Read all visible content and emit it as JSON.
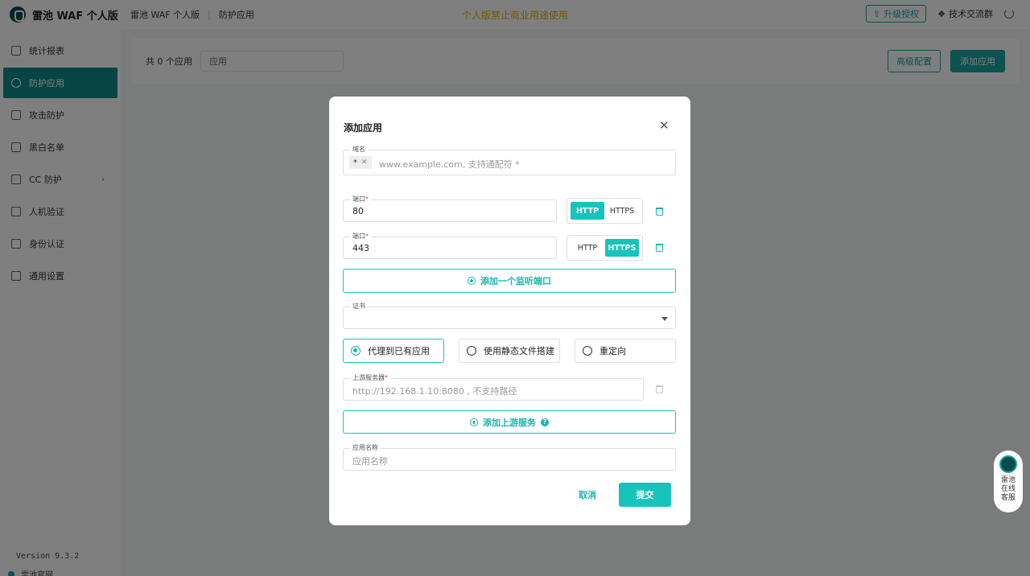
{
  "topbar": {
    "brand": "雷池 WAF 个人版",
    "breadcrumb": [
      "雷池 WAF 个人版",
      "防护应用"
    ],
    "notice": "个人版禁止商业用途使用",
    "upgrade_label": "升级授权",
    "tech_group_label": "技术交流群"
  },
  "sidebar": {
    "items": [
      {
        "label": "统计报表",
        "icon": "chart-icon"
      },
      {
        "label": "防护应用",
        "icon": "shield-icon"
      },
      {
        "label": "攻击防护",
        "icon": "document-icon"
      },
      {
        "label": "黑白名单",
        "icon": "list-icon"
      },
      {
        "label": "CC 防护",
        "icon": "wrench-icon"
      },
      {
        "label": "人机验证",
        "icon": "robot-icon"
      },
      {
        "label": "身份认证",
        "icon": "key-icon"
      },
      {
        "label": "通用设置",
        "icon": "gear-icon"
      }
    ],
    "active_index": 1,
    "version": "Version 9.3.2",
    "website": "雷池官网"
  },
  "main": {
    "count_text": "共 0 个应用",
    "search_value": "应用",
    "advanced_label": "高级配置",
    "add_app_label": "添加应用"
  },
  "support": {
    "text": "雷池在线客服"
  },
  "modal": {
    "title": "添加应用",
    "domain": {
      "label": "域名",
      "tag": "*",
      "placeholder": "www.example.com, 支持通配符 *"
    },
    "ports": [
      {
        "label": "端口",
        "value": "80",
        "protocol": "HTTP"
      },
      {
        "label": "端口",
        "value": "443",
        "protocol": "HTTPS"
      }
    ],
    "protocol_options": [
      "HTTP",
      "HTTPS"
    ],
    "add_port_label": "添加一个监听端口",
    "certificate": {
      "label": "证书",
      "value": ""
    },
    "modes": [
      "代理到已有应用",
      "使用静态文件搭建",
      "重定向"
    ],
    "selected_mode": 0,
    "upstream": {
      "label": "上游服务器",
      "placeholder": "http://192.168.1.10:8080 , 不支持路径"
    },
    "add_upstream_label": "添加上游服务",
    "app_name": {
      "label": "应用名称",
      "placeholder": "应用名称"
    },
    "cancel_label": "取消",
    "submit_label": "提交"
  },
  "colors": {
    "accent": "#16c4bc",
    "sidebar_active": "#0d8a86",
    "notice": "#e0b400",
    "required": "#e53935"
  }
}
